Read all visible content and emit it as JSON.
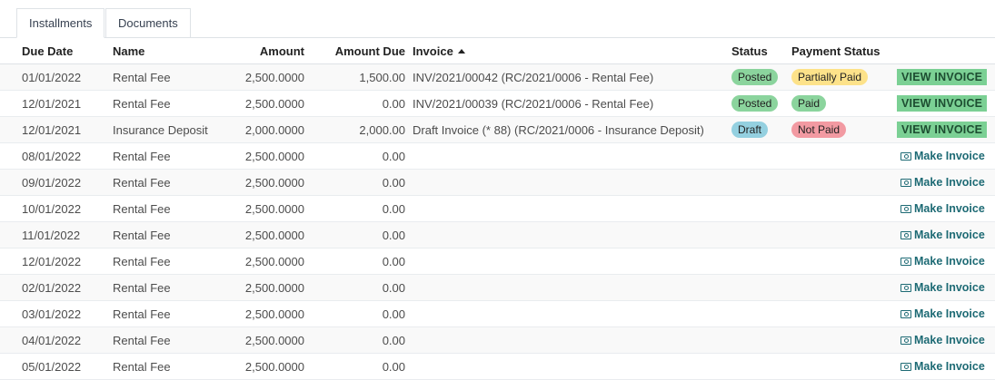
{
  "tabs": [
    {
      "label": "Installments",
      "active": true
    },
    {
      "label": "Documents",
      "active": false
    }
  ],
  "columns": {
    "due_date": "Due Date",
    "name": "Name",
    "amount": "Amount",
    "amount_due": "Amount Due",
    "invoice": "Invoice",
    "status": "Status",
    "payment_status": "Payment Status"
  },
  "rows": [
    {
      "due_date": "01/01/2022",
      "name": "Rental Fee",
      "amount": "2,500.0000",
      "amount_due": "1,500.00",
      "invoice": "INV/2021/00042 (RC/2021/0006 - Rental Fee)",
      "status": "Posted",
      "payment_status": "Partially Paid",
      "action": "VIEW INVOICE"
    },
    {
      "due_date": "12/01/2021",
      "name": "Rental Fee",
      "amount": "2,500.0000",
      "amount_due": "0.00",
      "invoice": "INV/2021/00039 (RC/2021/0006 - Rental Fee)",
      "status": "Posted",
      "payment_status": "Paid",
      "action": "VIEW INVOICE"
    },
    {
      "due_date": "12/01/2021",
      "name": "Insurance Deposit",
      "amount": "2,000.0000",
      "amount_due": "2,000.00",
      "invoice": "Draft Invoice (* 88) (RC/2021/0006 - Insurance Deposit)",
      "status": "Draft",
      "payment_status": "Not Paid",
      "action": "VIEW INVOICE"
    },
    {
      "due_date": "08/01/2022",
      "name": "Rental Fee",
      "amount": "2,500.0000",
      "amount_due": "0.00",
      "invoice": "",
      "status": "",
      "payment_status": "",
      "action": "Make Invoice"
    },
    {
      "due_date": "09/01/2022",
      "name": "Rental Fee",
      "amount": "2,500.0000",
      "amount_due": "0.00",
      "invoice": "",
      "status": "",
      "payment_status": "",
      "action": "Make Invoice"
    },
    {
      "due_date": "10/01/2022",
      "name": "Rental Fee",
      "amount": "2,500.0000",
      "amount_due": "0.00",
      "invoice": "",
      "status": "",
      "payment_status": "",
      "action": "Make Invoice"
    },
    {
      "due_date": "11/01/2022",
      "name": "Rental Fee",
      "amount": "2,500.0000",
      "amount_due": "0.00",
      "invoice": "",
      "status": "",
      "payment_status": "",
      "action": "Make Invoice"
    },
    {
      "due_date": "12/01/2022",
      "name": "Rental Fee",
      "amount": "2,500.0000",
      "amount_due": "0.00",
      "invoice": "",
      "status": "",
      "payment_status": "",
      "action": "Make Invoice"
    },
    {
      "due_date": "02/01/2022",
      "name": "Rental Fee",
      "amount": "2,500.0000",
      "amount_due": "0.00",
      "invoice": "",
      "status": "",
      "payment_status": "",
      "action": "Make Invoice"
    },
    {
      "due_date": "03/01/2022",
      "name": "Rental Fee",
      "amount": "2,500.0000",
      "amount_due": "0.00",
      "invoice": "",
      "status": "",
      "payment_status": "",
      "action": "Make Invoice"
    },
    {
      "due_date": "04/01/2022",
      "name": "Rental Fee",
      "amount": "2,500.0000",
      "amount_due": "0.00",
      "invoice": "",
      "status": "",
      "payment_status": "",
      "action": "Make Invoice"
    },
    {
      "due_date": "05/01/2022",
      "name": "Rental Fee",
      "amount": "2,500.0000",
      "amount_due": "0.00",
      "invoice": "",
      "status": "",
      "payment_status": "",
      "action": "Make Invoice"
    }
  ],
  "badge_colors": {
    "Posted": "#8bd49d",
    "Draft": "#94d0e0",
    "Partially Paid": "#fde28a",
    "Paid": "#8bd49d",
    "Not Paid": "#f29aa2"
  },
  "icons": {
    "sort": "sort-asc-icon",
    "make_invoice": "money-icon"
  }
}
